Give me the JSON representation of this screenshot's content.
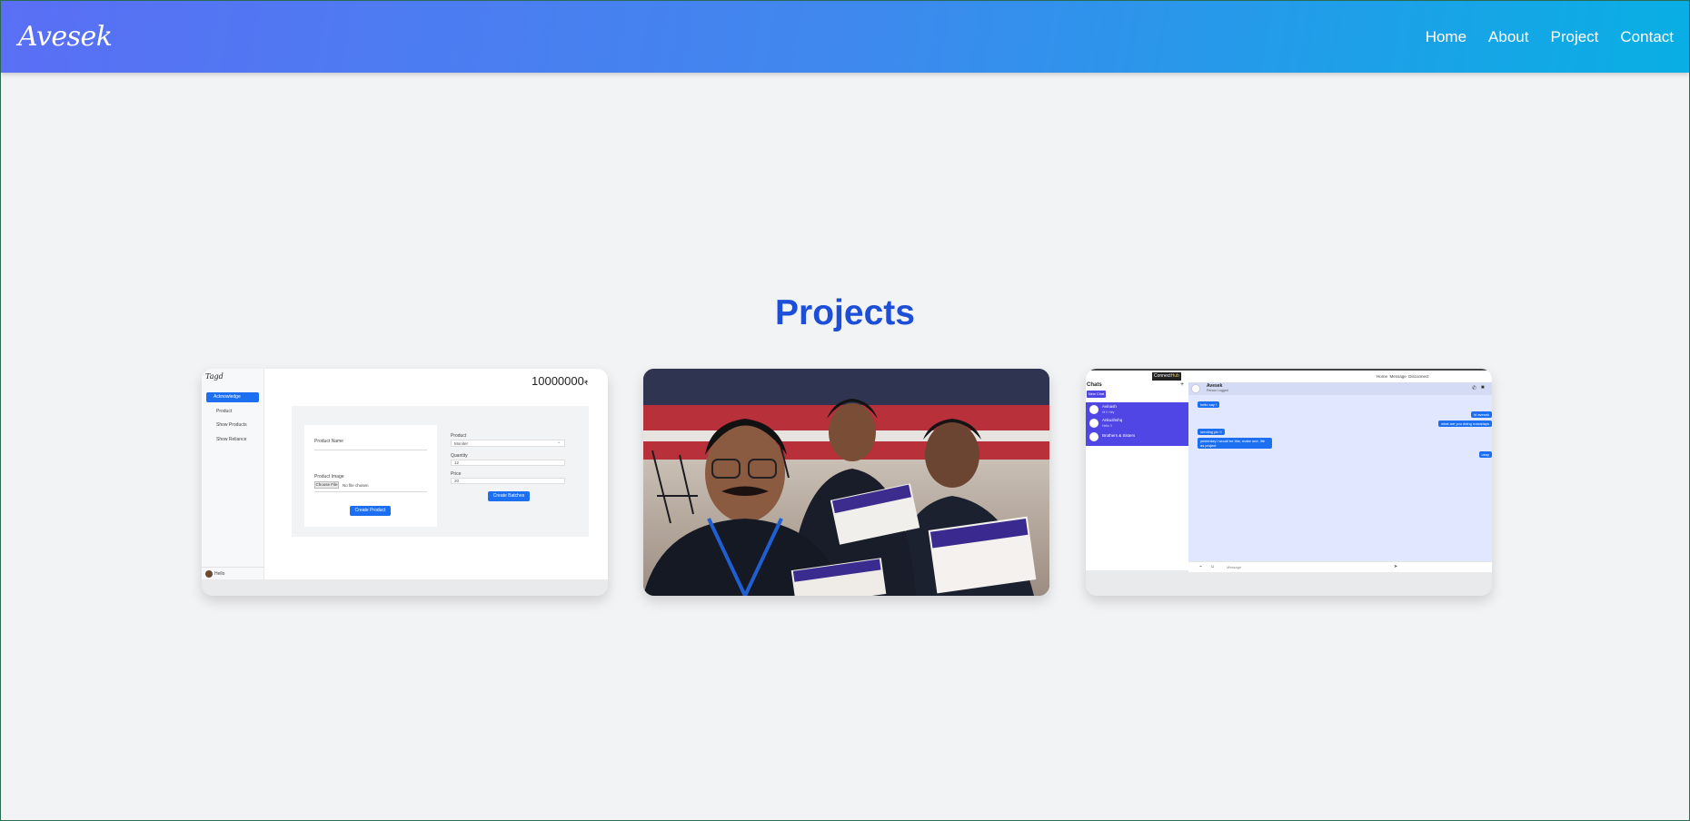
{
  "header": {
    "logo": "Avesek",
    "nav": [
      "Home",
      "About",
      "Project",
      "Contact"
    ]
  },
  "projects": {
    "title": "Projects",
    "card1": {
      "logo": "Tagd",
      "counter": "10000000",
      "counter_suffix": "₹",
      "sidebar": [
        "Acknowledge",
        "Product",
        "Show Products",
        "Show Reliance"
      ],
      "form_left": {
        "name_label": "Product Name",
        "image_label": "Product Image",
        "choose_file": "Choose File",
        "no_file": "No file chosen",
        "button": "Create Product"
      },
      "form_right": {
        "product_label": "Product",
        "product_value": "Moniter",
        "qty_label": "Quantity",
        "qty_value": "12",
        "price_label": "Price",
        "price_value": "20",
        "button": "Create Batches"
      },
      "user": "Hello"
    },
    "card3": {
      "top_links": "Home  Message  Disconnect",
      "brand_a": "Connect",
      "brand_b": "Hub",
      "chats_title": "Chats",
      "new_chat": "New Chat",
      "contacts": [
        "Avinash",
        "Ankushshq",
        "Brothers & Sisters"
      ],
      "contact_sub": [
        "Hi !! Hey",
        "Hello !!",
        ""
      ],
      "chat_header": "Avesek",
      "chat_sub": "Person Logged",
      "messages_left": [
        "hello say !",
        "sending pic !!",
        "yesterday i would be this, make one, life as project"
      ],
      "messages_right": [
        "hi avesek",
        "what are you doing nowadays",
        "okay"
      ],
      "input_placeholder": "Message"
    }
  },
  "colors": {
    "accent": "#1d4ed8",
    "nav_start": "#5a6ff5",
    "nav_end": "#08afe4",
    "chat_purple": "#4f46e5",
    "chat_blue": "#1d6ff2"
  }
}
